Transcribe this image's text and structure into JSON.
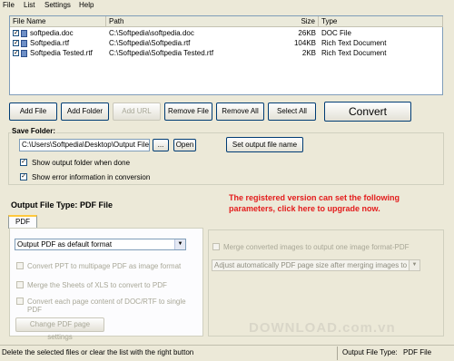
{
  "menu": [
    "File",
    "List",
    "Settings",
    "Help"
  ],
  "list": {
    "columns": [
      "File Name",
      "Path",
      "Size",
      "Type"
    ],
    "rows": [
      {
        "name": "softpedia.doc",
        "path": "C:\\Softpedia\\softpedia.doc",
        "size": "26KB",
        "type": "DOC File",
        "checked": true
      },
      {
        "name": "Softpedia.rtf",
        "path": "C:\\Softpedia\\Softpedia.rtf",
        "size": "104KB",
        "type": "Rich Text Document",
        "checked": true
      },
      {
        "name": "Softpedia Tested.rtf",
        "path": "C:\\Softpedia\\Softpedia Tested.rtf",
        "size": "2KB",
        "type": "Rich Text Document",
        "checked": true
      }
    ]
  },
  "buttons": {
    "add_file": "Add File",
    "add_folder": "Add Folder",
    "add_url": "Add URL",
    "remove_file": "Remove File",
    "remove_all": "Remove All",
    "select_all": "Select All",
    "convert": "Convert"
  },
  "save": {
    "label": "Save Folder:",
    "path": "C:\\Users\\Softpedia\\Desktop\\Output Files",
    "browse": "...",
    "open": "Open",
    "set_name": "Set output file name",
    "show_folder": "Show output folder when done",
    "show_errors": "Show error information in conversion"
  },
  "output": {
    "label": "Output File Type:",
    "value": "PDF File",
    "notice_line1": "The registered version can set the following",
    "notice_line2": "parameters, click here to upgrade now.",
    "tab": "PDF",
    "format_select": "Output PDF as default format",
    "opt_ppt": "Convert PPT to multipage PDF as image format",
    "opt_xls": "Merge the Sheets of XLS to convert to PDF",
    "opt_doc_line1": "Convert each page content of DOC/RTF to single",
    "opt_doc_line2": "PDF",
    "change_size": "Change PDF page settings",
    "merge_images": "Merge converted images to output one image format-PDF",
    "adjust_select": "Adjust automatically PDF page size after merging images to PD"
  },
  "status": {
    "left": "Delete the selected files or clear the list with the right button",
    "right_label": "Output File Type:",
    "right_value": "PDF File"
  },
  "watermark": "DOWNLOAD.com.vn"
}
